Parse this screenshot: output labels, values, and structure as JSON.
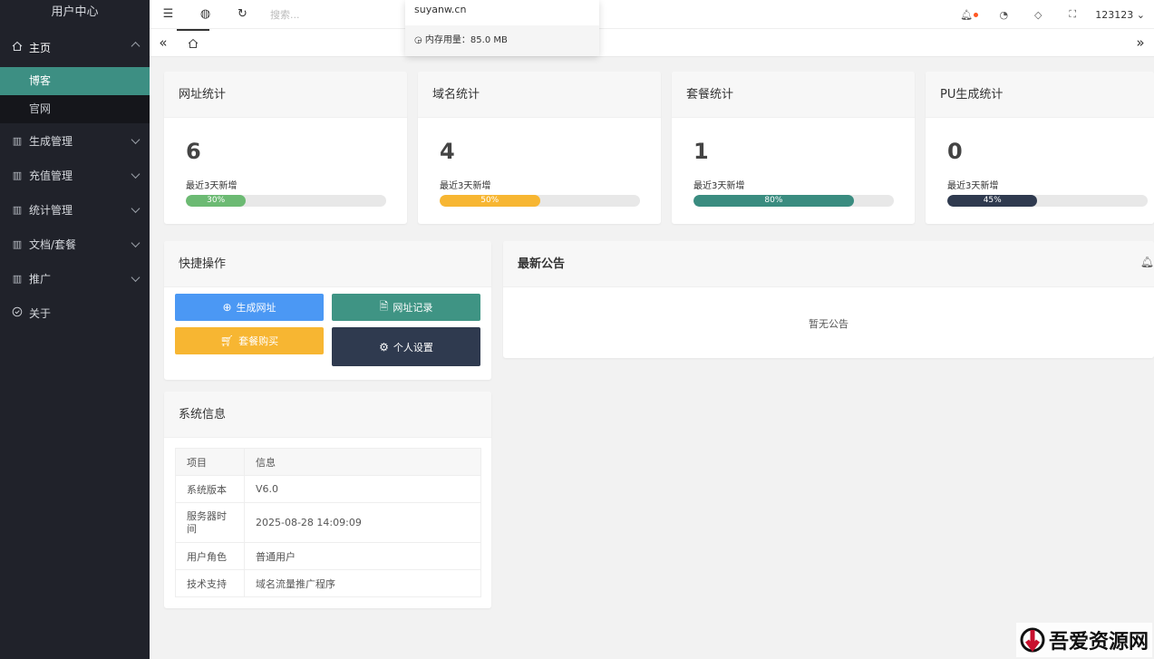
{
  "sidebar": {
    "title": "用户中心",
    "home": {
      "label": "主页",
      "children": [
        {
          "label": "博客",
          "active": true
        },
        {
          "label": "官网",
          "active": false
        }
      ]
    },
    "items": [
      {
        "label": "生成管理"
      },
      {
        "label": "充值管理"
      },
      {
        "label": "统计管理"
      },
      {
        "label": "文档/套餐"
      },
      {
        "label": "推广"
      }
    ],
    "about": {
      "label": "关于"
    }
  },
  "header": {
    "search_placeholder": "搜索...",
    "username": "123123"
  },
  "dropdown": {
    "domain": "suyanw.cn",
    "memory_label": "内存用量：85.0 MB"
  },
  "stats": [
    {
      "title": "网址统计",
      "value": "6",
      "sub": "最近3天新增",
      "percent": 30,
      "percent_label": "30%",
      "color": "#6cba73"
    },
    {
      "title": "域名统计",
      "value": "4",
      "sub": "最近3天新增",
      "percent": 50,
      "percent_label": "50%",
      "color": "#f7b632"
    },
    {
      "title": "套餐统计",
      "value": "1",
      "sub": "最近3天新增",
      "percent": 80,
      "percent_label": "80%",
      "color": "#3a8c80"
    },
    {
      "title": "PU生成统计",
      "value": "0",
      "sub": "最近3天新增",
      "percent": 45,
      "percent_label": "45%",
      "color": "#2f3a4f"
    }
  ],
  "quick": {
    "title": "快捷操作",
    "buttons": [
      {
        "label": "生成网址",
        "color": "#4b98f4",
        "icon": "plus-circle-icon"
      },
      {
        "label": "网址记录",
        "color": "#3f9484",
        "icon": "document-icon"
      },
      {
        "label": "套餐购买",
        "color": "#f7b632",
        "icon": "cart-icon"
      },
      {
        "label": "个人设置",
        "color": "#2f3a4f",
        "icon": "gear-icon"
      }
    ]
  },
  "notice": {
    "title": "最新公告",
    "empty_text": "暂无公告"
  },
  "sysinfo": {
    "title": "系统信息",
    "headers": [
      "项目",
      "信息"
    ],
    "rows": [
      {
        "k": "系统版本",
        "v": "V6.0"
      },
      {
        "k": "服务器时间",
        "v": "2025-08-28 14:09:09"
      },
      {
        "k": "用户角色",
        "v": "普通用户"
      },
      {
        "k": "技术支持",
        "v": "域名流量推广程序"
      }
    ]
  },
  "watermark": {
    "text": "吾爱资源网"
  }
}
